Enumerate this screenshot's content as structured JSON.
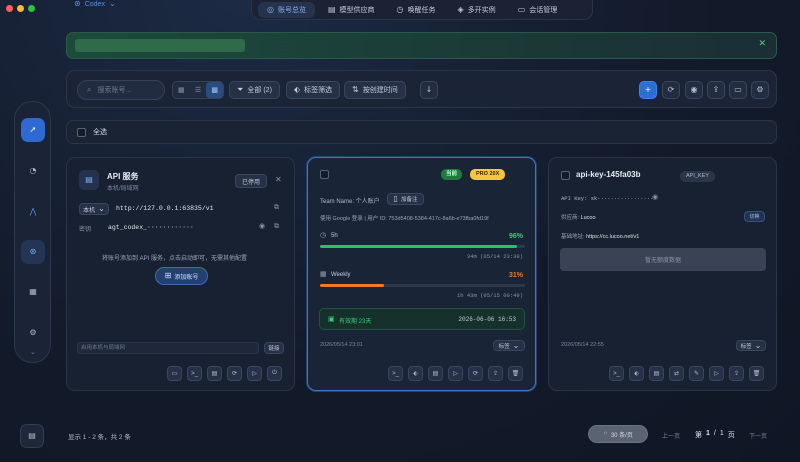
{
  "app": {
    "selector_label": "Codex"
  },
  "nav": {
    "tabs": [
      {
        "label": "账号总览",
        "icon": "target-icon",
        "active": true
      },
      {
        "label": "模型供应商",
        "icon": "server-icon"
      },
      {
        "label": "唤醒任务",
        "icon": "clock-icon"
      },
      {
        "label": "多开实例",
        "icon": "layers-icon"
      },
      {
        "label": "会话管理",
        "icon": "chat-icon"
      }
    ]
  },
  "toolbar": {
    "search_placeholder": "搜索账号...",
    "filter_all": "全部 (2)",
    "filter_tags": "标签筛选",
    "sort_by": "按创建时间"
  },
  "select_all": {
    "label": "全选"
  },
  "cards": {
    "api": {
      "title": "API 服务",
      "subtitle": "本机/局域网",
      "status_button": "已停用",
      "scope_select": "本机",
      "url": "http://127.0.0.1:63835/v1",
      "key_label": "密钥",
      "key_value": "agt_codex_············",
      "hint": "将账号添加到 API 服务，点击启动即可，无需其他配置",
      "add_button": "添加账号",
      "lan_placeholder": "启用本机与局域网",
      "lan_button": "链接"
    },
    "team": {
      "badge_current": "当前",
      "badge_plan": "PRO 20X",
      "team_name_label": "Team Name: 个人账户",
      "add_note": "加备注",
      "login_info": "使用 Google 登录 | 用户 ID: 753d5408-5384-417c-8a6b-e73fba0fd19f",
      "quota_5h_label": "5h",
      "quota_5h_percent": "96%",
      "quota_5h_value": 0.96,
      "quota_5h_reset": "34m (05/14 23:39)",
      "quota_weekly_label": "Weekly",
      "quota_weekly_percent": "31%",
      "quota_weekly_value": 0.31,
      "quota_weekly_reset": "1h 43m (05/15 00:49)",
      "expiry_label": "有效期 23天",
      "expiry_date": "2026-06-06 16:53",
      "created_at": "2026/05/14 23:01",
      "tag_select": "标签"
    },
    "apikey": {
      "title": "api-key-145fa03b",
      "badge": "API_KEY",
      "key_label": "API Key: sk-················",
      "provider_label": "供应商: ",
      "provider_value": "Lucoo",
      "provider_action": "切换",
      "base_url_label": "基础地址: ",
      "base_url_value": "https://cc.lucoo.net/v1",
      "disabled_button": "暂无额度数据",
      "created_at": "2026/05/14 22:55",
      "tag_select": "标签"
    }
  },
  "pagination": {
    "summary": "显示 1 - 2 条，共 2 条",
    "per_page": "30 条/页",
    "prev": "上一页",
    "page_prefix": "第",
    "current": "1",
    "separator": "/",
    "total": "1",
    "page_suffix": "页",
    "next": "下一页"
  },
  "colors": {
    "accent_blue": "#2f6ad3",
    "green": "#27c26a",
    "orange": "#f07a2a",
    "badge_green": "#22c55e",
    "badge_gold": "#f5c542"
  }
}
